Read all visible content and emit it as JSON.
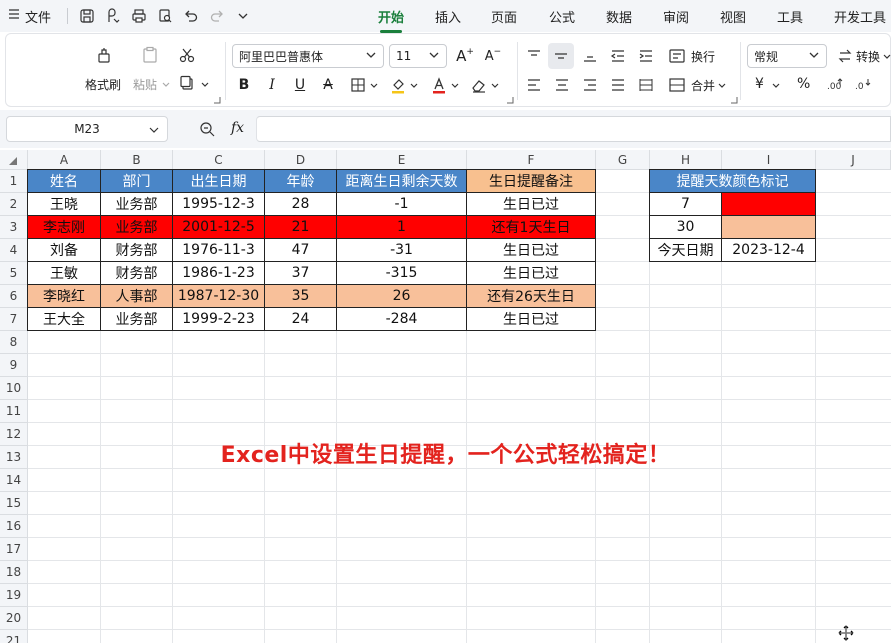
{
  "menubar": {
    "menu_icon": "hamburger-icon",
    "file_label": "文件",
    "tabs": [
      "开始",
      "插入",
      "页面",
      "公式",
      "数据",
      "审阅",
      "视图",
      "工具",
      "开发工具"
    ],
    "active_tab": "开始",
    "accent_color": "#1a7f3c"
  },
  "ribbon": {
    "format_painter": "格式刷",
    "paste": "粘贴",
    "font_name": "阿里巴巴普惠体",
    "font_size": "11",
    "wrap_text": "换行",
    "merge": "合并",
    "number_format": "常规",
    "convert": "转换",
    "bold": "B",
    "italic": "I",
    "underline": "U",
    "strike": "A",
    "increase_font": "A",
    "decrease_font": "A",
    "currency": "¥",
    "percent": "%"
  },
  "formula_bar": {
    "name_box": "M23",
    "fx_label": "fx",
    "formula": ""
  },
  "sheet": {
    "columns": [
      "A",
      "B",
      "C",
      "D",
      "E",
      "F",
      "G",
      "H",
      "I",
      "J"
    ],
    "rows": [
      "1",
      "2",
      "3",
      "4",
      "5",
      "6",
      "7",
      "8",
      "9",
      "10",
      "11",
      "12",
      "13",
      "14",
      "15",
      "16",
      "17",
      "18",
      "19",
      "20",
      "21"
    ],
    "header": [
      "姓名",
      "部门",
      "出生日期",
      "年龄",
      "距离生日剩余天数",
      "生日提醒备注"
    ],
    "data": [
      [
        "王晓",
        "业务部",
        "1995-12-3",
        "28",
        "-1",
        "生日已过"
      ],
      [
        "李志刚",
        "业务部",
        "2001-12-5",
        "21",
        "1",
        "还有1天生日"
      ],
      [
        "刘备",
        "财务部",
        "1976-11-3",
        "47",
        "-31",
        "生日已过"
      ],
      [
        "王敏",
        "财务部",
        "1986-1-23",
        "37",
        "-315",
        "生日已过"
      ],
      [
        "李晓红",
        "人事部",
        "1987-12-30",
        "35",
        "26",
        "还有26天生日"
      ],
      [
        "王大全",
        "业务部",
        "1999-2-23",
        "24",
        "-284",
        "生日已过"
      ]
    ],
    "row_highlight": [
      "",
      "red",
      "",
      "",
      "peach",
      ""
    ],
    "legend": {
      "title": "提醒天数颜色标记",
      "rows": [
        {
          "days": "7",
          "color": "red"
        },
        {
          "days": "30",
          "color": "peach"
        }
      ],
      "today_label": "今天日期",
      "today_value": "2023-12-4"
    },
    "colors": {
      "header_blue": "#4a86c8",
      "header_peach": "#f8c08f",
      "red": "#ff0000",
      "peach": "#f8c09a"
    }
  },
  "caption": "Excel中设置生日提醒，一个公式轻松搞定！"
}
